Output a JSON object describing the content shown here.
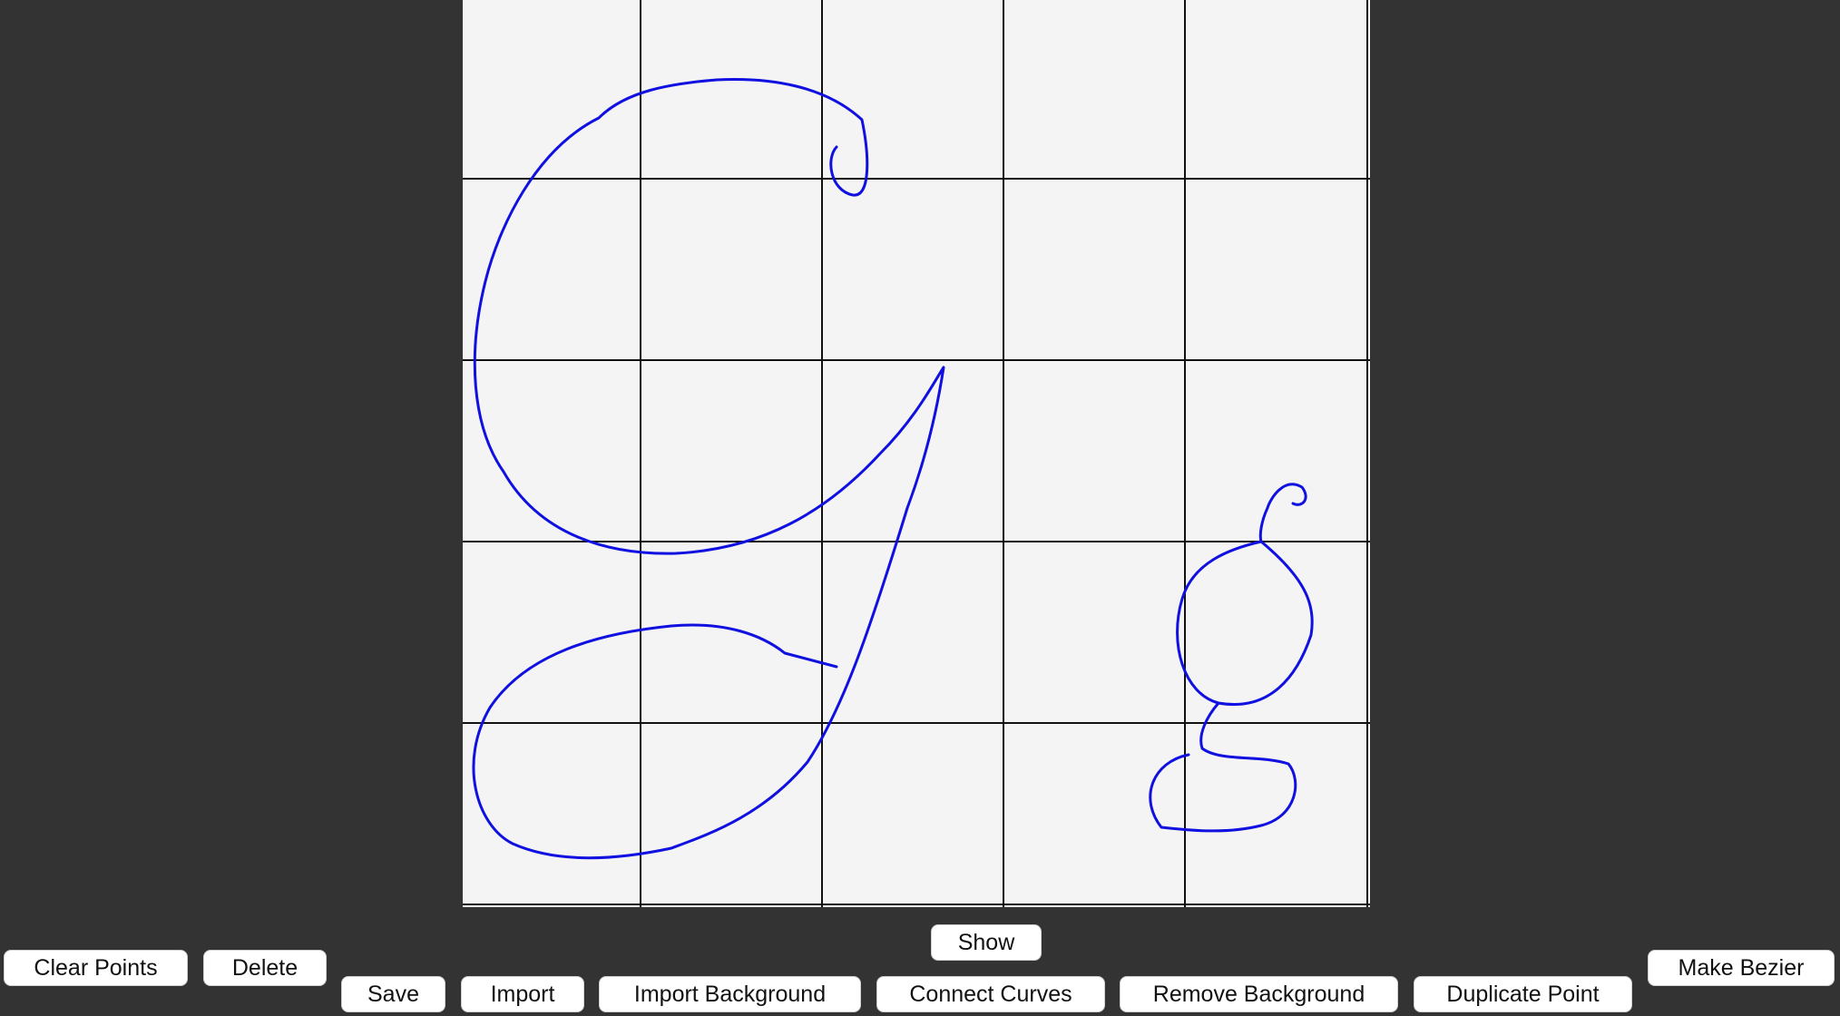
{
  "colors": {
    "window_bg": "#333333",
    "canvas_bg": "#f4f4f4",
    "grid": "#111111",
    "curve": "#1010e0"
  },
  "grid": {
    "divisions": 5
  },
  "buttons": {
    "show": "Show",
    "clear_points": "Clear Points",
    "delete": "Delete",
    "save": "Save",
    "import": "Import",
    "import_background": "Import Background",
    "connect_curves": "Connect Curves",
    "remove_background": "Remove Background",
    "duplicate_point": "Duplicate Point",
    "make_bezier": "Make Bezier"
  }
}
